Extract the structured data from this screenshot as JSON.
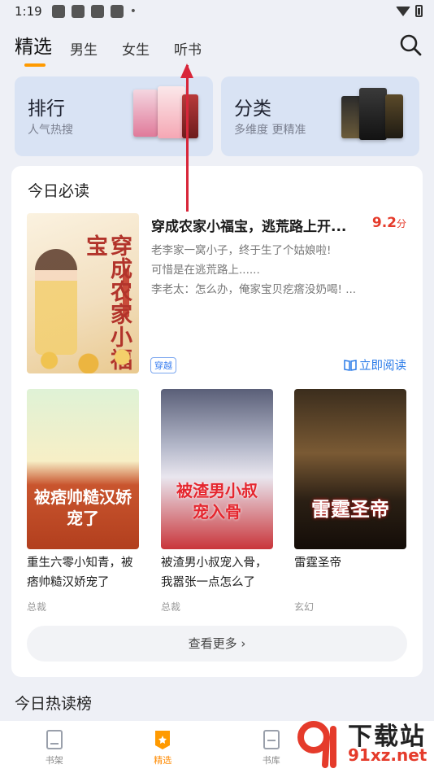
{
  "status": {
    "time": "1:19"
  },
  "tabs": [
    {
      "label": "精选",
      "active": true
    },
    {
      "label": "男生"
    },
    {
      "label": "女生"
    },
    {
      "label": "听书"
    }
  ],
  "categories": [
    {
      "title": "排行",
      "subtitle": "人气热搜"
    },
    {
      "title": "分类",
      "subtitle": "多维度 更精准"
    }
  ],
  "today": {
    "section_title": "今日必读",
    "featured": {
      "title": "穿成农家小福宝，逃荒路上开...",
      "score": "9.2",
      "score_unit": "分",
      "desc": [
        "老李家一窝小子，终于生了个姑娘啦!",
        "可惜是在逃荒路上......",
        "李老太：怎么办，俺家宝贝疙瘩没奶喝! ..."
      ],
      "genre": "穿越",
      "read_label": "立即阅读",
      "cover_text": "穿成农家小福宝"
    },
    "books": [
      {
        "name": "重生六零小知青，被痞帅糙汉娇宠了",
        "genre": "总裁",
        "cover_text": "被痞帅糙汉娇宠了"
      },
      {
        "name": "被渣男小叔宠入骨，我嚣张一点怎么了",
        "genre": "总裁",
        "cover_text": "被渣男小叔宠入骨"
      },
      {
        "name": "雷霆圣帝",
        "genre": "玄幻",
        "cover_text": "雷霆圣帝"
      }
    ],
    "more_label": "查看更多"
  },
  "hot_title": "今日热读榜",
  "nav": [
    {
      "label": "书架",
      "icon": "bookshelf-icon"
    },
    {
      "label": "精选",
      "icon": "featured-icon",
      "active": true
    },
    {
      "label": "书库",
      "icon": "library-icon"
    }
  ],
  "watermark": {
    "text": "下载站",
    "url": "91xz.net"
  },
  "colors": {
    "accent": "#ff9a00",
    "score": "#e53b2b",
    "link": "#2a7be8",
    "arrow": "#d8263a"
  }
}
